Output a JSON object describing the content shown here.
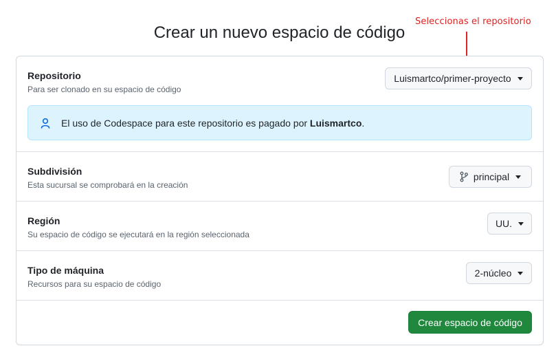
{
  "page": {
    "title": "Crear un nuevo espacio de código"
  },
  "annotation": {
    "text": "Seleccionas el repositorio",
    "color": "#e02020"
  },
  "repository": {
    "title": "Repositorio",
    "description": "Para ser clonado en su espacio de código",
    "selected": "Luismartco/primer-proyecto"
  },
  "notice": {
    "text_before": "El uso de Codespace para este repositorio es pagado por ",
    "owner": "Luismartco",
    "text_after": "."
  },
  "branch": {
    "title": "Subdivisión",
    "description": "Esta sucursal se comprobará en la creación",
    "selected": "principal"
  },
  "region": {
    "title": "Región",
    "description": "Su espacio de código se ejecutará en la región seleccionada",
    "selected": "UU."
  },
  "machine": {
    "title": "Tipo de máquina",
    "description": "Recursos para su espacio de código",
    "selected": "2-núcleo"
  },
  "actions": {
    "create_label": "Crear espacio de código"
  },
  "colors": {
    "primary_button": "#1f883d",
    "notice_bg": "#ddf4ff",
    "border": "#d0d7de"
  },
  "icons": {
    "notice": "person-icon",
    "branch": "git-branch-icon",
    "dropdown": "caret-down-icon",
    "annotation": "red-arrow-icon"
  }
}
